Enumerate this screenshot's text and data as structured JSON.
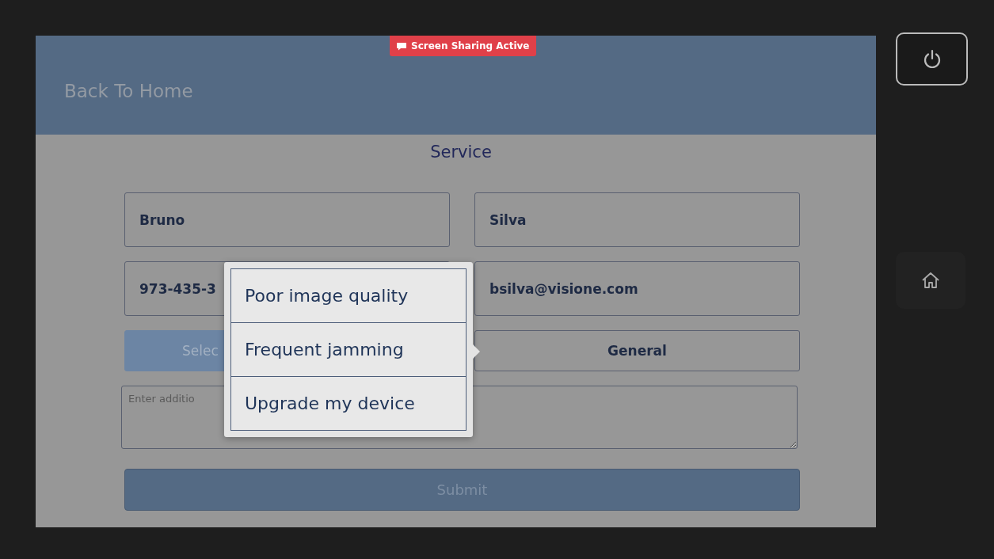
{
  "header": {
    "back_link": "Back To Home"
  },
  "badge": {
    "label": "Screen Sharing Active"
  },
  "title": "Service",
  "fields": [
    {
      "value": "Bruno"
    },
    {
      "value": "Silva"
    },
    {
      "value": "973-435-3"
    },
    {
      "value": "bsilva@visione.com"
    }
  ],
  "select_button": {
    "label": "Selec"
  },
  "category_button": {
    "label": "General"
  },
  "notes": {
    "placeholder": "Enter additio"
  },
  "submit": {
    "label": "Submit"
  },
  "popup_menu": {
    "items": [
      {
        "label": "Poor image quality"
      },
      {
        "label": "Frequent jamming"
      },
      {
        "label": "Upgrade my device"
      }
    ]
  }
}
